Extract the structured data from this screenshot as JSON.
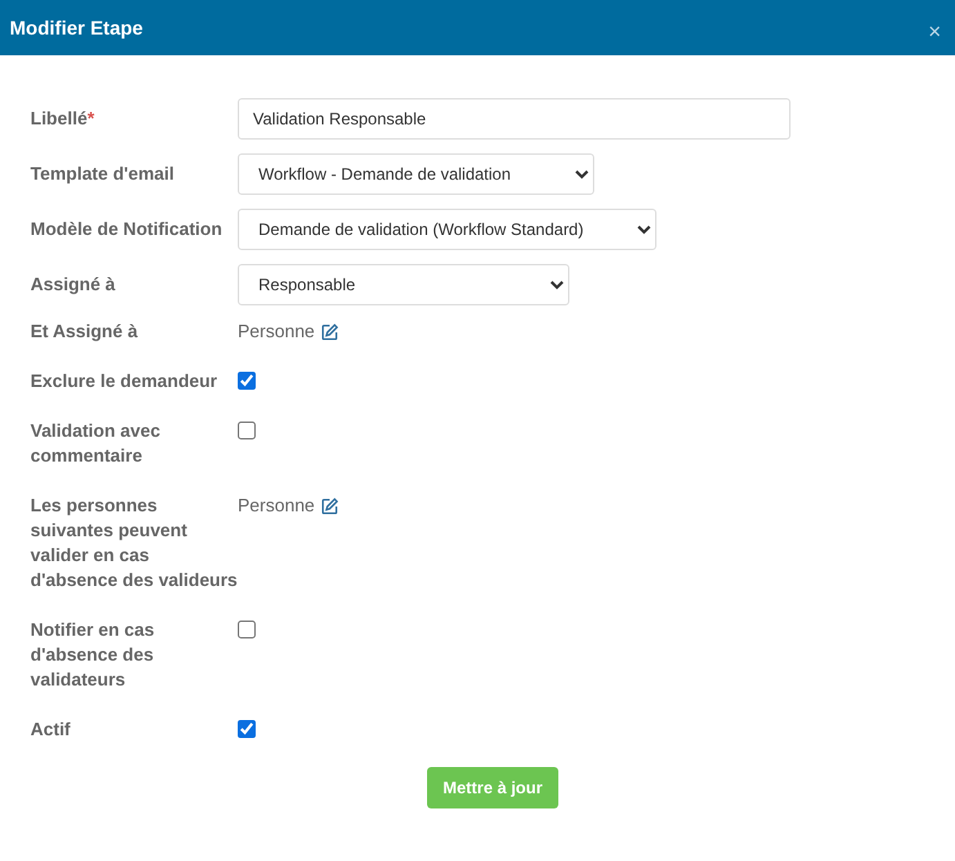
{
  "window": {
    "title": "Modifier Etape",
    "close": "×"
  },
  "fields": [
    {
      "kind": "text",
      "label": "Libellé",
      "required_mark": "*",
      "value": "Validation Responsable"
    },
    {
      "kind": "select",
      "label": "Template d'email",
      "value": "Workflow - Demande de validation"
    },
    {
      "kind": "select",
      "label": "Modèle de Notification",
      "value": "Demande de validation (Workflow Standard)"
    },
    {
      "kind": "select",
      "label": "Assigné à",
      "value": "Responsable"
    },
    {
      "kind": "person",
      "label": "Et Assigné à",
      "value": "Personne"
    },
    {
      "kind": "checkbox",
      "label": "Exclure le demandeur",
      "checked": true
    },
    {
      "kind": "checkbox",
      "label": "Validation avec commentaire",
      "checked": false
    },
    {
      "kind": "person",
      "label": "Les personnes suivantes peuvent valider en cas d'absence des valideurs",
      "value": "Personne"
    },
    {
      "kind": "checkbox",
      "label": "Notifier en cas d'absence des validateurs",
      "checked": false
    },
    {
      "kind": "checkbox",
      "label": "Actif",
      "checked": true
    }
  ],
  "submit_button": "Mettre à jour"
}
